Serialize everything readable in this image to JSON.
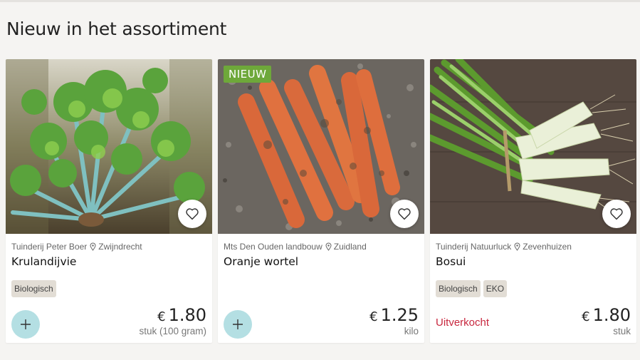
{
  "section": {
    "title": "Nieuw in het assortiment"
  },
  "products": [
    {
      "producer": "Tuinderij Peter Boer",
      "location": "Zwijndrecht",
      "name": "Krulandijvie",
      "tags": [
        "Biologisch"
      ],
      "currency": "€",
      "price": "1.80",
      "unit": "stuk (100 gram)",
      "add_icon": "plus-icon",
      "fav_icon": "heart-outline-icon"
    },
    {
      "badge": "NIEUW",
      "producer": "Mts Den Ouden landbouw",
      "location": "Zuidland",
      "name": "Oranje wortel",
      "tags": [],
      "currency": "€",
      "price": "1.25",
      "unit": "kilo",
      "add_icon": "plus-icon",
      "fav_icon": "heart-outline-icon"
    },
    {
      "producer": "Tuinderij Natuurluck",
      "location": "Zevenhuizen",
      "name": "Bosui",
      "tags": [
        "Biologisch",
        "EKO"
      ],
      "status": "Uitverkocht",
      "currency": "€",
      "price": "1.80",
      "unit": "stuk",
      "fav_icon": "heart-outline-icon"
    }
  ],
  "colors": {
    "new_badge": "#6ea83a",
    "add_button": "#b4dfe3",
    "sold_out": "#c8283f",
    "tag_bg": "#e2ddd5"
  }
}
